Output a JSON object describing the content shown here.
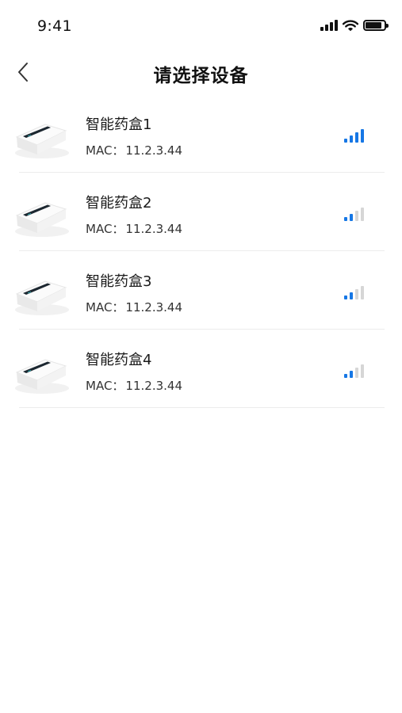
{
  "status_bar": {
    "time": "9:41",
    "cellular_icon": "cellular-signal-icon",
    "wifi_icon": "wifi-icon",
    "battery_icon": "battery-icon",
    "battery_level": 0.85
  },
  "nav": {
    "back_icon": "chevron-left-icon",
    "title": "请选择设备"
  },
  "colors": {
    "signal_active": "#1677e5",
    "signal_inactive": "#d6d6d6",
    "divider": "#ececec"
  },
  "devices": [
    {
      "name": "智能药盒1",
      "mac_label": "MAC：",
      "mac": "11.2.3.44",
      "signal_bars": 4,
      "signal_max": 4
    },
    {
      "name": "智能药盒2",
      "mac_label": "MAC：",
      "mac": "11.2.3.44",
      "signal_bars": 2,
      "signal_max": 4
    },
    {
      "name": "智能药盒3",
      "mac_label": "MAC：",
      "mac": "11.2.3.44",
      "signal_bars": 2,
      "signal_max": 4
    },
    {
      "name": "智能药盒4",
      "mac_label": "MAC：",
      "mac": "11.2.3.44",
      "signal_bars": 2,
      "signal_max": 4
    }
  ]
}
